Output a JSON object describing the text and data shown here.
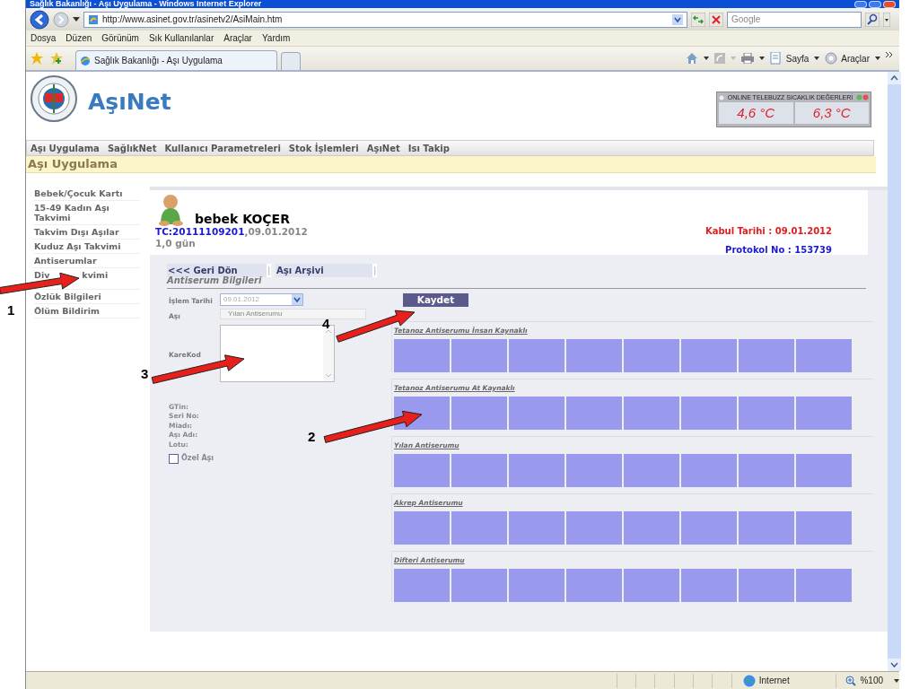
{
  "browser": {
    "title": "Sağlık Bakanlığı - Aşı Uygulama - Windows Internet Explorer",
    "url": "http://www.asinet.gov.tr/asinetv2/AsiMain.htm",
    "search": {
      "placeholder": "Google"
    },
    "menu": [
      "Dosya",
      "Düzen",
      "Görünüm",
      "Sık Kullanılanlar",
      "Araçlar",
      "Yardım"
    ],
    "tab": "Sağlık Bakanlığı - Aşı Uygulama",
    "tools": [
      "Sayfa",
      "Araçlar"
    ],
    "status": {
      "zone": "Internet",
      "zoom": "%100"
    }
  },
  "site": {
    "logo": "AşıNet",
    "temperature": {
      "title": "ONLINE TELEBUZZ SICAKLIK DEĞERLERİ",
      "readings": [
        "4,6 °C",
        "6,3 °C"
      ]
    },
    "nav": [
      "Aşı Uygulama",
      "SağlıkNet",
      "Kullanıcı Parametreleri",
      "Stok İşlemleri",
      "AşıNet",
      "Isı Takip"
    ],
    "section": "Aşı Uygulama",
    "sidebar": [
      {
        "label": "Bebek/Çocuk Kartı"
      },
      {
        "label": "15-49 Kadın Aşı Takvimi"
      },
      {
        "label": "Takvim Dışı Aşılar"
      },
      {
        "label": "Kuduz Aşı Takvimi"
      },
      {
        "label": "Antiserumlar"
      },
      {
        "label": "Div",
        "label_end": "kvimi"
      },
      {
        "label": "Özlük Bilgileri"
      },
      {
        "label": "Ölüm Bildirim"
      }
    ]
  },
  "patient": {
    "name": "bebek KOÇER",
    "tc": "TC:20111109201",
    "birth": ",09.01.2012",
    "age": "1,0 gün",
    "admission": "Kabul Tarihi : 09.01.2012",
    "protocol": "Protokol No : 153739"
  },
  "tabs": [
    {
      "label": "<<< Geri Dön",
      "separator": "|"
    },
    {
      "label": "Aşı Arşivi",
      "separator": "|"
    }
  ],
  "form": {
    "title": "Antiserum Bilgileri",
    "fields": [
      {
        "label": "İşlem Tarihi",
        "kind": "date",
        "value": "09.01.2012"
      },
      {
        "label": "Aşı",
        "kind": "select",
        "value": "Yılan Antiserumu"
      },
      {
        "label": "KareKod",
        "kind": "textarea"
      }
    ],
    "info": [
      "GTin:",
      "Seri No:",
      "Miadı:",
      "Aşı Adı:",
      "Lotu:"
    ],
    "special": {
      "label": "Özel Aşı",
      "checked": false
    },
    "save": "Kaydet"
  },
  "groups": [
    {
      "title": "Tetanoz Antiserumu İnsan Kaynaklı"
    },
    {
      "title": "Tetanoz Antiserumu At Kaynaklı"
    },
    {
      "title": "Yılan Antiserumu"
    },
    {
      "title": "Akrep Antiserumu"
    },
    {
      "title": "Difteri Antiserumu"
    }
  ],
  "annotations": [
    {
      "label": "1"
    },
    {
      "label": "2"
    },
    {
      "label": "3"
    },
    {
      "label": "4"
    }
  ]
}
